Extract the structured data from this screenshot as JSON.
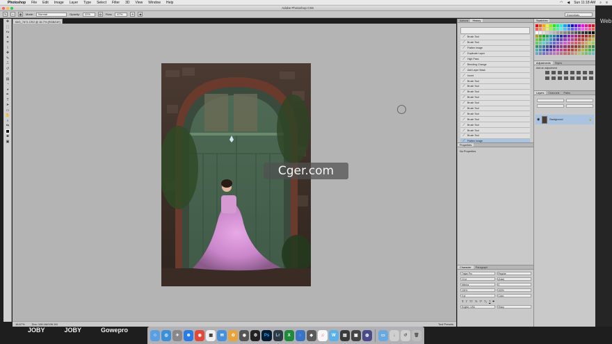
{
  "menubar": {
    "app": "Photoshop",
    "items": [
      "File",
      "Edit",
      "Image",
      "Layer",
      "Type",
      "Select",
      "Filter",
      "3D",
      "View",
      "Window",
      "Help"
    ],
    "clock": "Sun 11:18 AM"
  },
  "window": {
    "title": "Adobe Photoshop CS6"
  },
  "options": {
    "mode_label": "Mode:",
    "mode_value": "Normal",
    "opacity_label": "Opacity:",
    "opacity_value": "22%",
    "flow_label": "Flow:",
    "flow_value": "67%",
    "workspace": "Essentials"
  },
  "document": {
    "tab": "IMG_7671.CR2 @ 16.7% (RGB/16*)",
    "zoom": "16.67%",
    "doc_size": "Doc: 106.1M/106.1M"
  },
  "watermark": {
    "text": "Cger.com"
  },
  "history": {
    "tabs": [
      "Actions",
      "History"
    ],
    "items": [
      "Brush Tool",
      "Brush Tool",
      "Flatten Image",
      "Duplicate Layer",
      "High Pass",
      "Blending Change",
      "Add Layer Mask",
      "Invert",
      "Brush Tool",
      "Brush Tool",
      "Brush Tool",
      "Brush Tool",
      "Brush Tool",
      "Brush Tool",
      "Brush Tool",
      "Brush Tool",
      "Brush Tool",
      "Brush Tool",
      "Brush Tool",
      "Flatten Image"
    ]
  },
  "properties": {
    "tab": "Properties",
    "empty": "No Properties"
  },
  "character": {
    "tabs": [
      "Character",
      "Paragraph"
    ],
    "font": "Trajan Pro",
    "style": "Regular",
    "size": "12 pt",
    "leading": "(Auto)",
    "kerning": "Metrics",
    "tracking": "0",
    "vscale": "100%",
    "hscale": "100%",
    "baseline": "0 pt",
    "color_label": "Color:",
    "lang": "English: USA",
    "aa": "Sharp",
    "buttons": [
      "T",
      "T",
      "TT",
      "Tt",
      "T¹",
      "T₁",
      "T",
      "T"
    ]
  },
  "swatches": {
    "tab": "Swatches"
  },
  "adjustments": {
    "tabs": [
      "Adjustments",
      "Styles"
    ],
    "label": "Add an adjustment"
  },
  "layers": {
    "tabs": [
      "Layers",
      "Channels",
      "Paths"
    ],
    "layer_name": "Background"
  },
  "statusbar": {
    "tool_label": "Tool Presets"
  },
  "desktop": {
    "logos": [
      "JOBY",
      "JOBY",
      "Gowepro"
    ],
    "right_label": "Web"
  }
}
